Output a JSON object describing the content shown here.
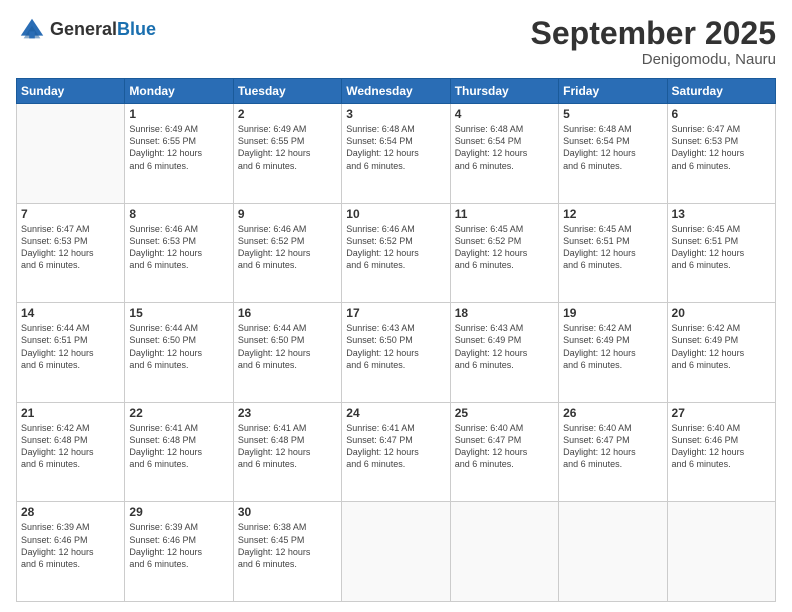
{
  "header": {
    "logo_general": "General",
    "logo_blue": "Blue",
    "month": "September 2025",
    "location": "Denigomodu, Nauru"
  },
  "weekdays": [
    "Sunday",
    "Monday",
    "Tuesday",
    "Wednesday",
    "Thursday",
    "Friday",
    "Saturday"
  ],
  "weeks": [
    [
      {
        "day": "",
        "info": ""
      },
      {
        "day": "1",
        "info": "Sunrise: 6:49 AM\nSunset: 6:55 PM\nDaylight: 12 hours\nand 6 minutes."
      },
      {
        "day": "2",
        "info": "Sunrise: 6:49 AM\nSunset: 6:55 PM\nDaylight: 12 hours\nand 6 minutes."
      },
      {
        "day": "3",
        "info": "Sunrise: 6:48 AM\nSunset: 6:54 PM\nDaylight: 12 hours\nand 6 minutes."
      },
      {
        "day": "4",
        "info": "Sunrise: 6:48 AM\nSunset: 6:54 PM\nDaylight: 12 hours\nand 6 minutes."
      },
      {
        "day": "5",
        "info": "Sunrise: 6:48 AM\nSunset: 6:54 PM\nDaylight: 12 hours\nand 6 minutes."
      },
      {
        "day": "6",
        "info": "Sunrise: 6:47 AM\nSunset: 6:53 PM\nDaylight: 12 hours\nand 6 minutes."
      }
    ],
    [
      {
        "day": "7",
        "info": "Sunrise: 6:47 AM\nSunset: 6:53 PM\nDaylight: 12 hours\nand 6 minutes."
      },
      {
        "day": "8",
        "info": "Sunrise: 6:46 AM\nSunset: 6:53 PM\nDaylight: 12 hours\nand 6 minutes."
      },
      {
        "day": "9",
        "info": "Sunrise: 6:46 AM\nSunset: 6:52 PM\nDaylight: 12 hours\nand 6 minutes."
      },
      {
        "day": "10",
        "info": "Sunrise: 6:46 AM\nSunset: 6:52 PM\nDaylight: 12 hours\nand 6 minutes."
      },
      {
        "day": "11",
        "info": "Sunrise: 6:45 AM\nSunset: 6:52 PM\nDaylight: 12 hours\nand 6 minutes."
      },
      {
        "day": "12",
        "info": "Sunrise: 6:45 AM\nSunset: 6:51 PM\nDaylight: 12 hours\nand 6 minutes."
      },
      {
        "day": "13",
        "info": "Sunrise: 6:45 AM\nSunset: 6:51 PM\nDaylight: 12 hours\nand 6 minutes."
      }
    ],
    [
      {
        "day": "14",
        "info": "Sunrise: 6:44 AM\nSunset: 6:51 PM\nDaylight: 12 hours\nand 6 minutes."
      },
      {
        "day": "15",
        "info": "Sunrise: 6:44 AM\nSunset: 6:50 PM\nDaylight: 12 hours\nand 6 minutes."
      },
      {
        "day": "16",
        "info": "Sunrise: 6:44 AM\nSunset: 6:50 PM\nDaylight: 12 hours\nand 6 minutes."
      },
      {
        "day": "17",
        "info": "Sunrise: 6:43 AM\nSunset: 6:50 PM\nDaylight: 12 hours\nand 6 minutes."
      },
      {
        "day": "18",
        "info": "Sunrise: 6:43 AM\nSunset: 6:49 PM\nDaylight: 12 hours\nand 6 minutes."
      },
      {
        "day": "19",
        "info": "Sunrise: 6:42 AM\nSunset: 6:49 PM\nDaylight: 12 hours\nand 6 minutes."
      },
      {
        "day": "20",
        "info": "Sunrise: 6:42 AM\nSunset: 6:49 PM\nDaylight: 12 hours\nand 6 minutes."
      }
    ],
    [
      {
        "day": "21",
        "info": "Sunrise: 6:42 AM\nSunset: 6:48 PM\nDaylight: 12 hours\nand 6 minutes."
      },
      {
        "day": "22",
        "info": "Sunrise: 6:41 AM\nSunset: 6:48 PM\nDaylight: 12 hours\nand 6 minutes."
      },
      {
        "day": "23",
        "info": "Sunrise: 6:41 AM\nSunset: 6:48 PM\nDaylight: 12 hours\nand 6 minutes."
      },
      {
        "day": "24",
        "info": "Sunrise: 6:41 AM\nSunset: 6:47 PM\nDaylight: 12 hours\nand 6 minutes."
      },
      {
        "day": "25",
        "info": "Sunrise: 6:40 AM\nSunset: 6:47 PM\nDaylight: 12 hours\nand 6 minutes."
      },
      {
        "day": "26",
        "info": "Sunrise: 6:40 AM\nSunset: 6:47 PM\nDaylight: 12 hours\nand 6 minutes."
      },
      {
        "day": "27",
        "info": "Sunrise: 6:40 AM\nSunset: 6:46 PM\nDaylight: 12 hours\nand 6 minutes."
      }
    ],
    [
      {
        "day": "28",
        "info": "Sunrise: 6:39 AM\nSunset: 6:46 PM\nDaylight: 12 hours\nand 6 minutes."
      },
      {
        "day": "29",
        "info": "Sunrise: 6:39 AM\nSunset: 6:46 PM\nDaylight: 12 hours\nand 6 minutes."
      },
      {
        "day": "30",
        "info": "Sunrise: 6:38 AM\nSunset: 6:45 PM\nDaylight: 12 hours\nand 6 minutes."
      },
      {
        "day": "",
        "info": ""
      },
      {
        "day": "",
        "info": ""
      },
      {
        "day": "",
        "info": ""
      },
      {
        "day": "",
        "info": ""
      }
    ]
  ]
}
